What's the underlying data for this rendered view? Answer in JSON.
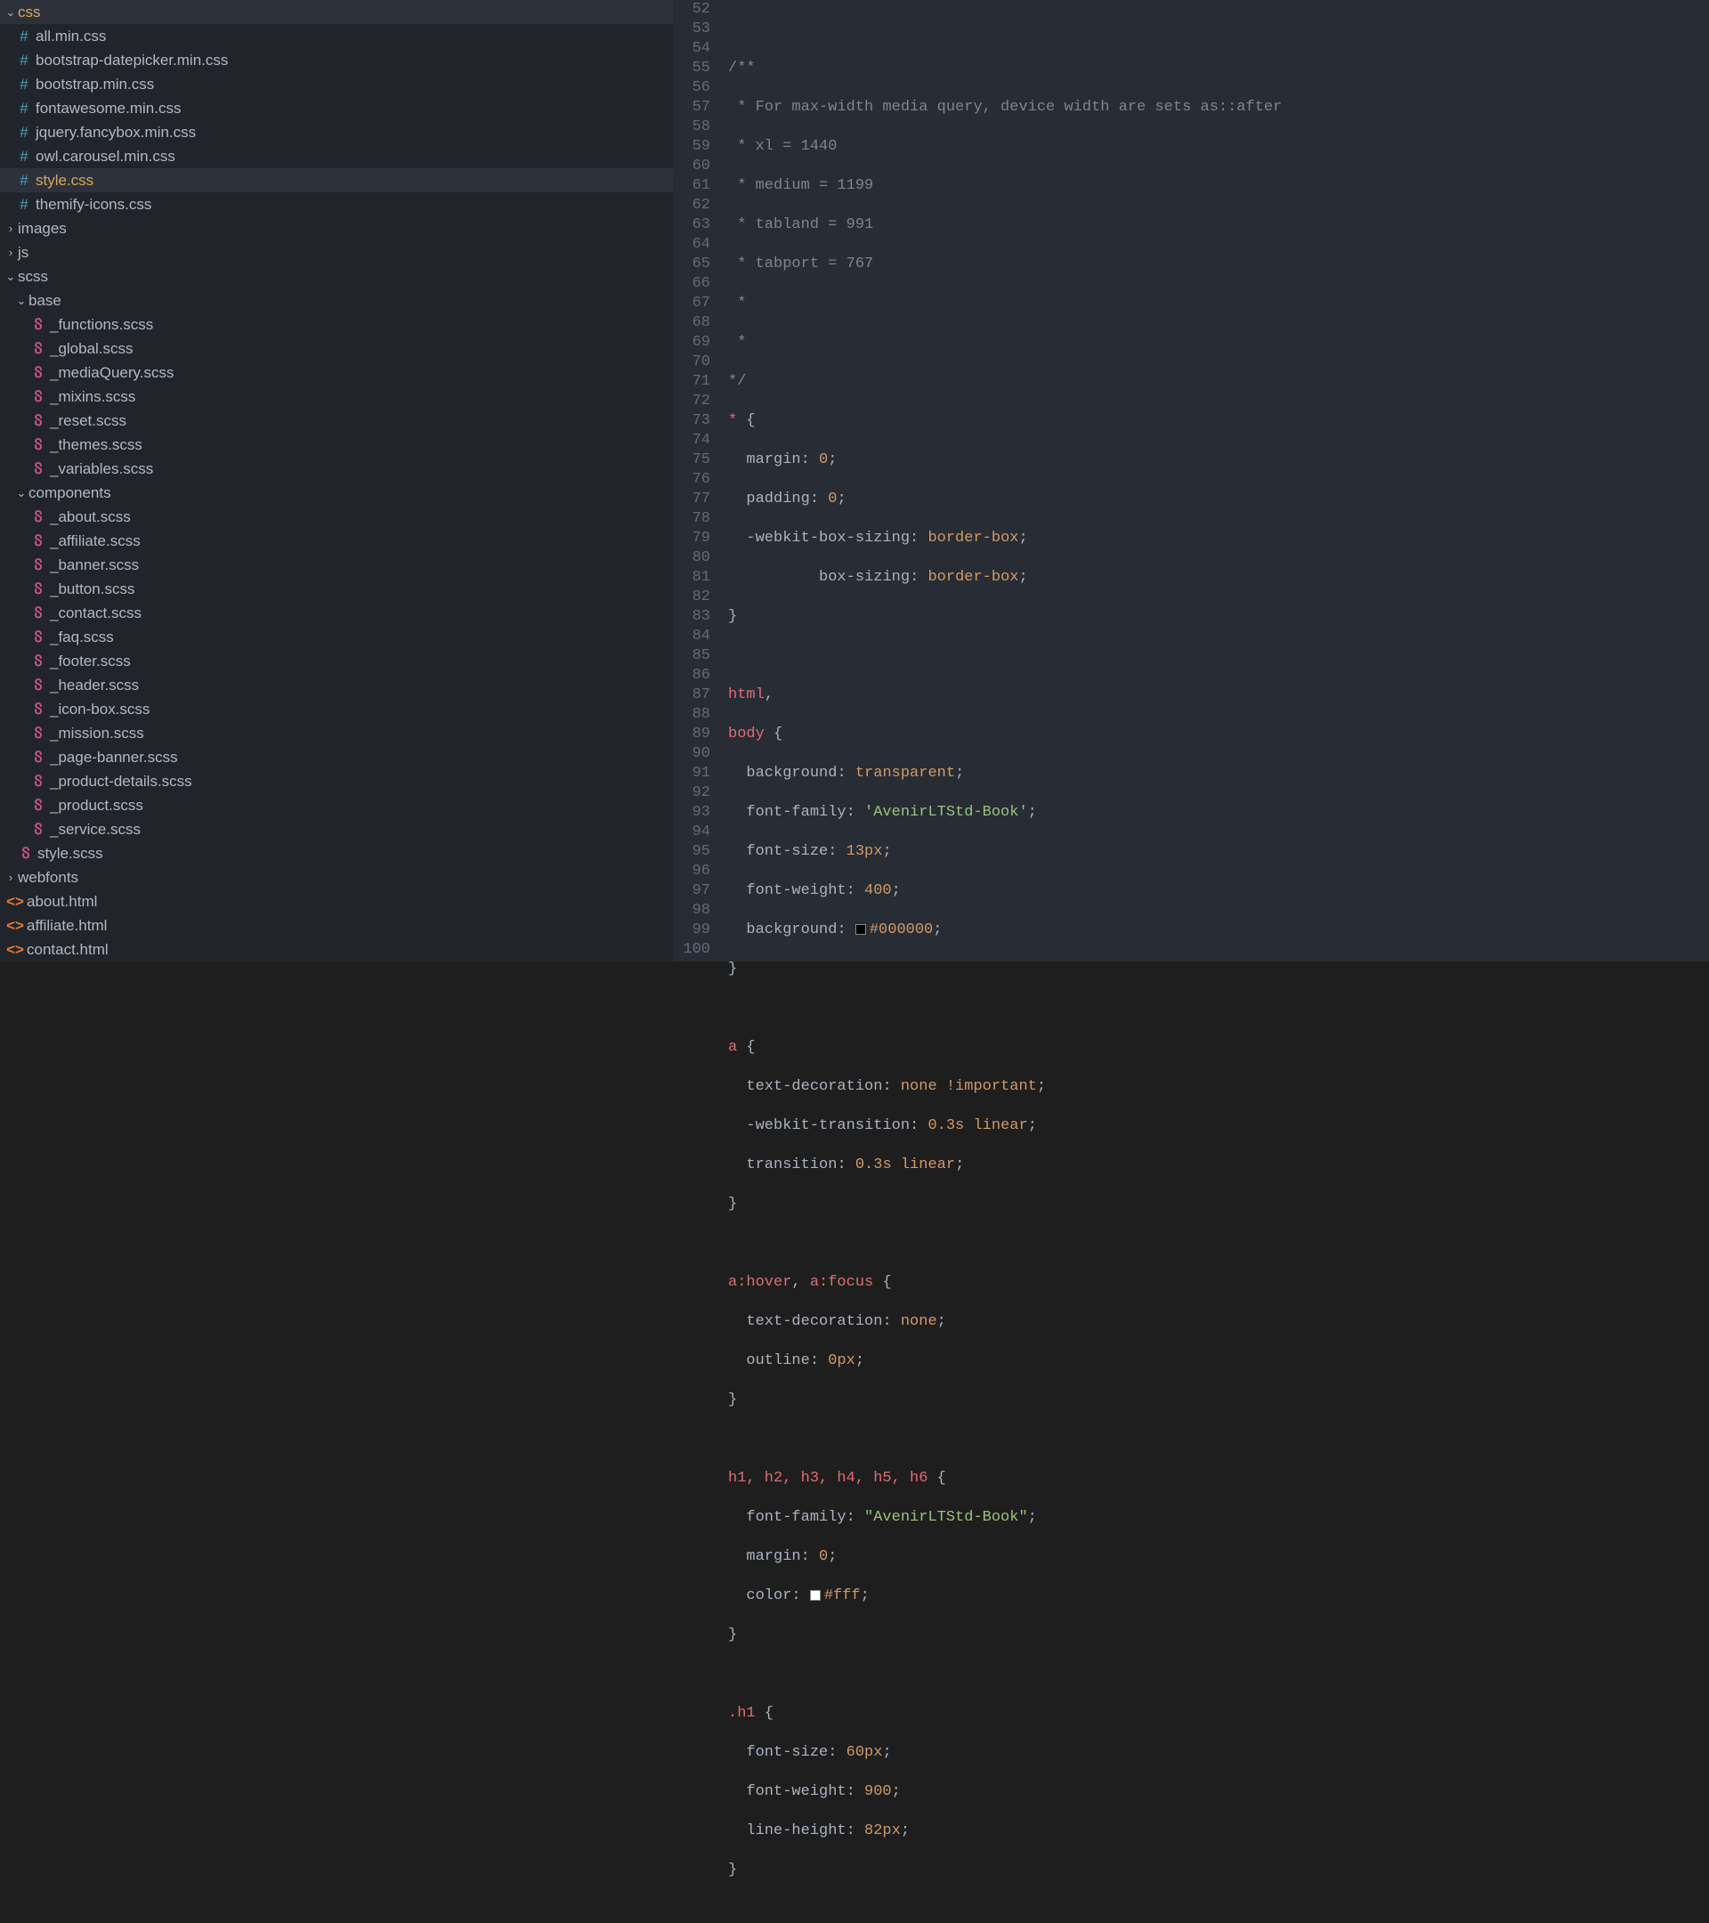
{
  "sidebar": {
    "cssFolder": "css",
    "cssFiles": [
      "all.min.css",
      "bootstrap-datepicker.min.css",
      "bootstrap.min.css",
      "fontawesome.min.css",
      "jquery.fancybox.min.css",
      "owl.carousel.min.css",
      "style.css",
      "themify-icons.css"
    ],
    "selectedCss": "style.css",
    "images": "images",
    "js": "js",
    "scss": "scss",
    "base": "base",
    "baseFiles": [
      "_functions.scss",
      "_global.scss",
      "_mediaQuery.scss",
      "_mixins.scss",
      "_reset.scss",
      "_themes.scss",
      "_variables.scss"
    ],
    "components": "components",
    "componentFiles": [
      "_about.scss",
      "_affiliate.scss",
      "_banner.scss",
      "_button.scss",
      "_contact.scss",
      "_faq.scss",
      "_footer.scss",
      "_header.scss",
      "_icon-box.scss",
      "_mission.scss",
      "_page-banner.scss",
      "_product-details.scss",
      "_product.scss",
      "_service.scss"
    ],
    "styleScss": "style.scss",
    "webfonts": "webfonts",
    "htmlFiles": [
      "about.html",
      "affiliate.html",
      "contact.html"
    ]
  },
  "gutter": {
    "start": 52,
    "end": 100
  },
  "code": {
    "l52": "",
    "l53": "/**",
    "l54": " * For max-width media query, device width are sets as::after",
    "l55": " * xl = 1440",
    "l56": " * medium = 1199",
    "l57": " * tabland = 991",
    "l58": " * tabport = 767",
    "l59": " *",
    "l60": " *",
    "l61": "*/",
    "l62_sel": "*",
    "l63_prop": "margin",
    "l63_val": " 0",
    "l64_prop": "padding",
    "l64_val": " 0",
    "l65_prop": "-webkit-box-sizing",
    "l65_val": " border-box",
    "l66_prop": "box-sizing",
    "l66_val": " border-box",
    "l67": "}",
    "l68": "",
    "l69_sel": "html",
    "l70_sel": "body",
    "l71_prop": "background",
    "l71_val": " transparent",
    "l72_prop": "font-family",
    "l72_val": "'AvenirLTStd-Book'",
    "l73_prop": "font-size",
    "l73_val": " 13px",
    "l74_prop": "font-weight",
    "l74_val": " 400",
    "l75_prop": "background",
    "l75_val": "#000000",
    "l76": "}",
    "l77": "",
    "l78_sel": "a",
    "l79_prop": "text-decoration",
    "l79_val": " none",
    "l79_imp": " !important",
    "l80_prop": "-webkit-transition",
    "l80_val1": " 0.3s ",
    "l80_val2": "linear",
    "l81_prop": "transition",
    "l81_val1": " 0.3s ",
    "l81_val2": "linear",
    "l82": "}",
    "l83": "",
    "l84_sel1": "a:hover",
    "l84_sel2": "a:focus",
    "l85_prop": "text-decoration",
    "l85_val": " none",
    "l86_prop": "outline",
    "l86_val": " 0px",
    "l87": "}",
    "l88": "",
    "l89_sel": "h1, h2, h3, h4, h5, h6",
    "l90_prop": "font-family",
    "l90_val": "\"AvenirLTStd-Book\"",
    "l91_prop": "margin",
    "l91_val": " 0",
    "l92_prop": "color",
    "l92_val": "#fff",
    "l93": "}",
    "l94": "",
    "l95_sel": ".h1",
    "l96_prop": "font-size",
    "l96_val": " 60px",
    "l97_prop": "font-weight",
    "l97_val": " 900",
    "l98_prop": "line-height",
    "l98_val": " 82px",
    "l99": "}",
    "l100": ""
  }
}
